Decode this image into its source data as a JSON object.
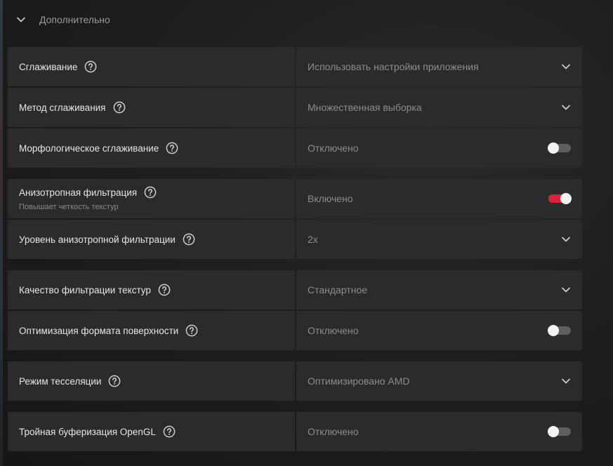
{
  "section": {
    "title": "Дополнительно"
  },
  "settings": [
    {
      "label": "Сглаживание",
      "value": "Использовать настройки приложения",
      "control": "dropdown"
    },
    {
      "label": "Метод сглаживания",
      "value": "Множественная выборка",
      "control": "dropdown"
    },
    {
      "label": "Морфологическое сглаживание",
      "value": "Отключено",
      "control": "toggle",
      "state": "off"
    },
    {
      "label": "Анизотропная фильтрация",
      "sublabel": "Повышает четкость текстур",
      "value": "Включено",
      "control": "toggle",
      "state": "on"
    },
    {
      "label": "Уровень анизотропной фильтрации",
      "value": "2x",
      "control": "dropdown"
    },
    {
      "label": "Качество фильтрации текстур",
      "value": "Стандартное",
      "control": "dropdown"
    },
    {
      "label": "Оптимизация формата поверхности",
      "value": "Отключено",
      "control": "toggle",
      "state": "off"
    },
    {
      "label": "Режим тесселяции",
      "value": "Оптимизировано AMD",
      "control": "dropdown"
    },
    {
      "label": "Тройная буферизация OpenGL",
      "value": "Отключено",
      "control": "toggle",
      "state": "off"
    }
  ],
  "colors": {
    "accent": "#d8233a",
    "panel": "#2b2b2b",
    "label_text": "#e6e6e6",
    "value_text": "#8c8c8c"
  },
  "icons": {
    "section_toggle": "chevron-down-icon",
    "help": "question-circle-icon",
    "dropdown": "chevron-down-icon"
  }
}
